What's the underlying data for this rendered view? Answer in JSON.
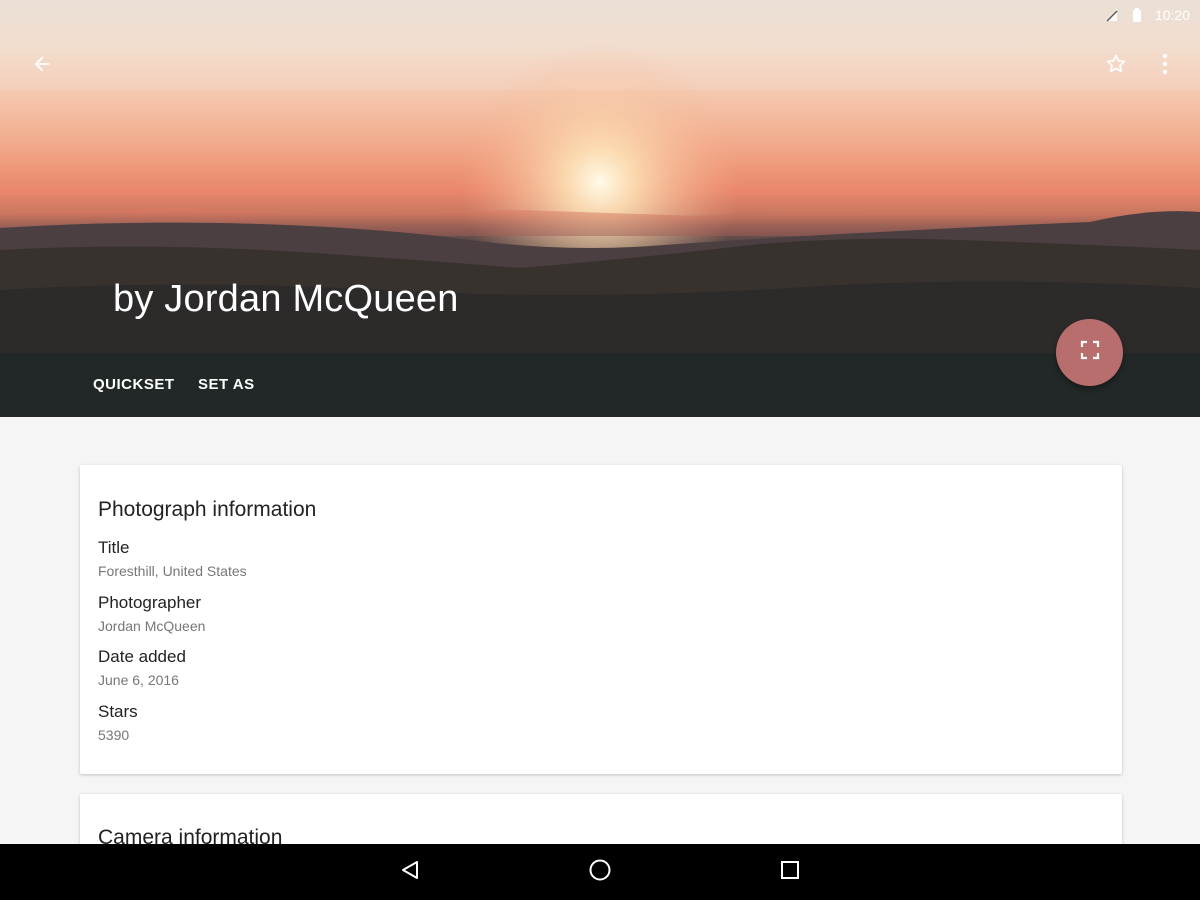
{
  "status_bar": {
    "time": "10:20"
  },
  "hero": {
    "title": "by Jordan McQueen"
  },
  "actions": {
    "quickset": "QUICKSET",
    "set_as": "SET AS"
  },
  "photo_card": {
    "heading": "Photograph information",
    "fields": [
      {
        "label": "Title",
        "value": "Foresthill, United States"
      },
      {
        "label": "Photographer",
        "value": "Jordan McQueen"
      },
      {
        "label": "Date added",
        "value": "June 6, 2016"
      },
      {
        "label": "Stars",
        "value": "5390"
      }
    ]
  },
  "camera_card": {
    "heading": "Camera information"
  },
  "icons": {
    "back": "arrow-left-icon",
    "favorite": "star-outline-icon",
    "overflow": "more-vertical-icon",
    "fullscreen": "fullscreen-icon",
    "nav_back": "triangle-back-icon",
    "nav_home": "circle-home-icon",
    "nav_recents": "square-recents-icon"
  },
  "colors": {
    "action_bar": "#222827",
    "fab": "#b86e6c",
    "background": "#f5f5f5",
    "card": "#ffffff"
  }
}
